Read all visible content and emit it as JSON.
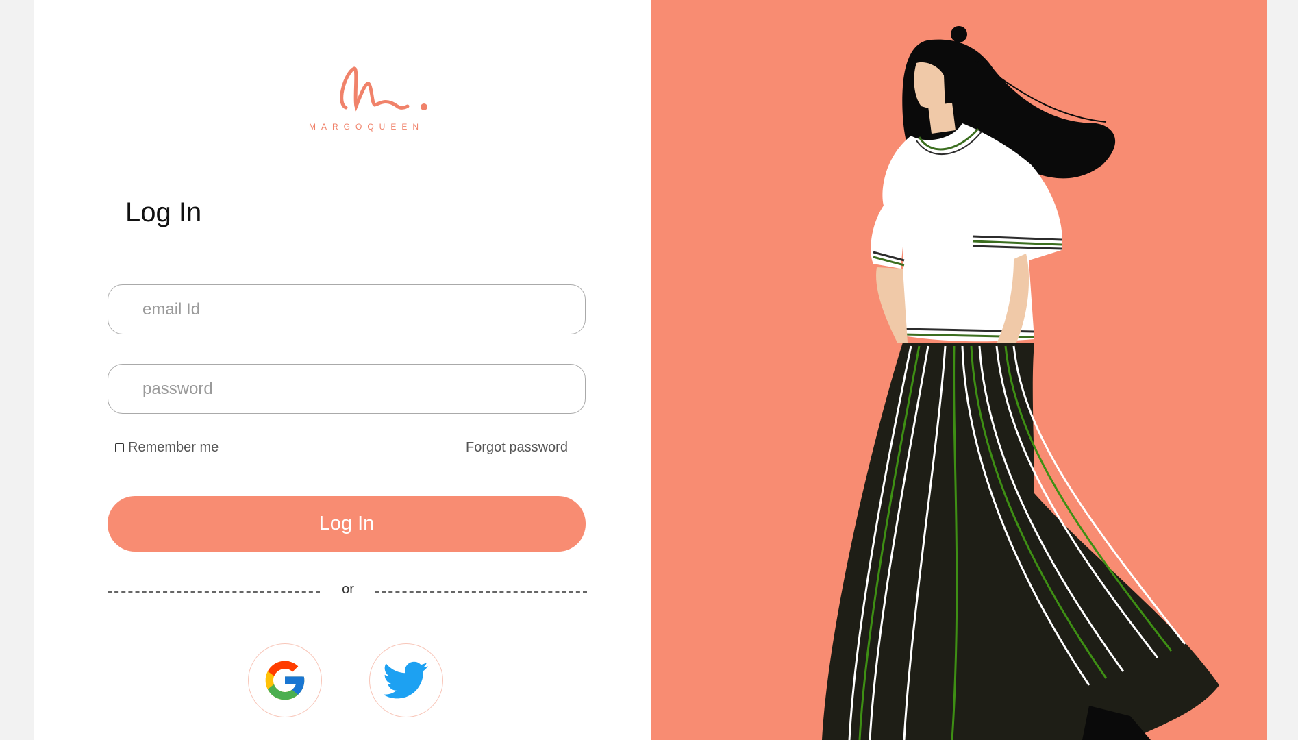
{
  "brand": {
    "logo_text": "MARGOQUEEN",
    "accent_color": "#f88c72"
  },
  "login": {
    "title": "Log In",
    "email_placeholder": "email Id",
    "password_placeholder": "password",
    "remember_label": "Remember me",
    "remember_checked": false,
    "forgot_label": "Forgot password",
    "submit_label": "Log In",
    "divider_text": "or"
  },
  "social": [
    {
      "icon": "google-icon"
    },
    {
      "icon": "twitter-icon"
    }
  ],
  "illustration": {
    "icon": "woman-illustration"
  }
}
